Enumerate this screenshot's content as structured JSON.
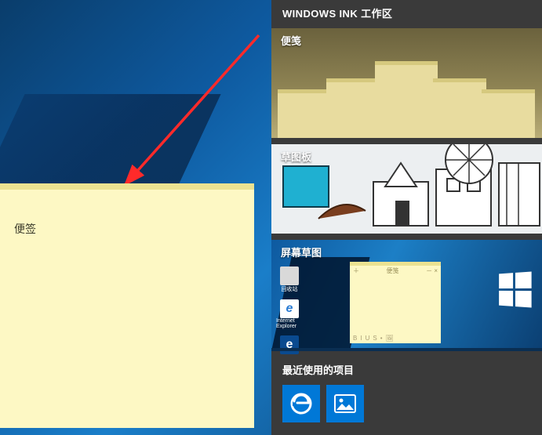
{
  "sticky_note": {
    "text": "便签"
  },
  "ink_panel": {
    "title": "WINDOWS INK 工作区",
    "tiles": {
      "sticky": {
        "label": "便笺"
      },
      "sketchpad": {
        "label": "草图板"
      },
      "screen_sketch": {
        "label": "屏幕草图",
        "desktop_icons": [
          {
            "label": "回收站"
          },
          {
            "label": "Internet Explorer"
          },
          {
            "label": "Edge"
          }
        ],
        "mini_sticky_label": "便笺"
      }
    },
    "recent": {
      "label": "最近使用的项目",
      "apps": [
        {
          "name": "edge"
        },
        {
          "name": "photos"
        }
      ]
    }
  }
}
